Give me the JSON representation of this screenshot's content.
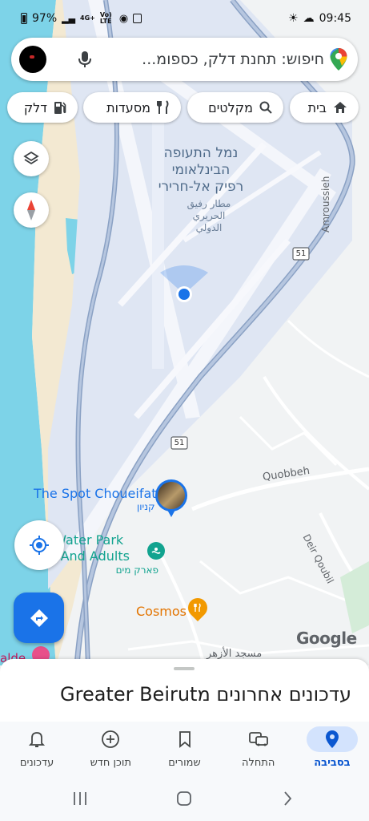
{
  "status_bar": {
    "battery": "97%",
    "network": "4G+",
    "volte": "Vo) LTE",
    "time": "09:45"
  },
  "search": {
    "placeholder": "חיפוש: תחנת דלק, כספומ..."
  },
  "chips": [
    {
      "label": "בית",
      "icon": "home-icon"
    },
    {
      "label": "מקלטים",
      "icon": "search-icon"
    },
    {
      "label": "מסעדות",
      "icon": "restaurant-icon"
    },
    {
      "label": "דלק",
      "icon": "gas-station-icon"
    }
  ],
  "map": {
    "airport_he_1": "נמל התעופה",
    "airport_he_2": "הבינלאומי",
    "airport_he_3": "רפיק אל-חרירי",
    "airport_ar_1": "مطار رفيق",
    "airport_ar_2": "الحريري",
    "airport_ar_3": "الدولي",
    "route_51": "51",
    "amroussieh": "Amroussieh",
    "quobbeh": "Quobbeh",
    "deir_qoubil": "Deir Qoubil",
    "spot_name": "The Spot Choueifat",
    "spot_sub": "קניון",
    "waterpark_1": "n Water Park",
    "waterpark_2": "ds And Adults",
    "waterpark_sub": "פארק מים",
    "cosmos": "Cosmos",
    "mosque": "مسجد الأزهر",
    "left_edge_label": "alde",
    "google_logo": "Google"
  },
  "bottom_sheet": {
    "title": "עדכונים אחרונים מGreater Beirut"
  },
  "bottom_nav": [
    {
      "label": "בסביבה",
      "icon": "location-pin-icon",
      "active": true
    },
    {
      "label": "התחלה",
      "icon": "commute-icon",
      "active": false
    },
    {
      "label": "שמורים",
      "icon": "bookmark-icon",
      "active": false
    },
    {
      "label": "תוכן חדש",
      "icon": "add-circle-icon",
      "active": false
    },
    {
      "label": "עדכונים",
      "icon": "bell-icon",
      "active": false
    }
  ],
  "colors": {
    "accent": "#1a73e8",
    "water": "#7dd3e8",
    "land": "#f1f3f4",
    "airport": "#dfe6f3",
    "sand": "#f3e9d2"
  }
}
